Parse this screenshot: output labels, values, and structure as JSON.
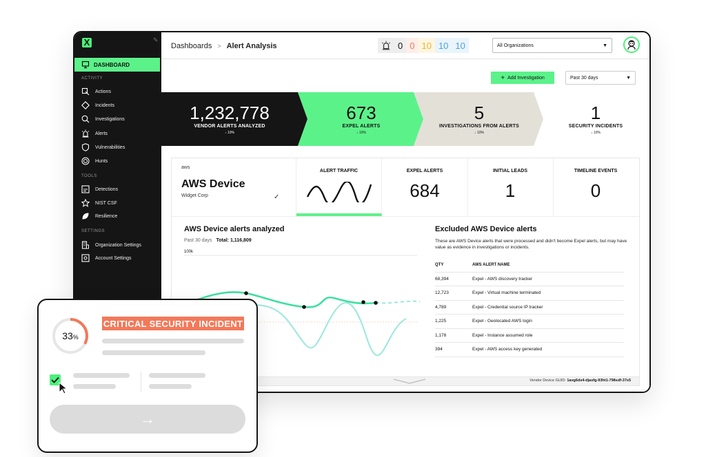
{
  "sidebar": {
    "logo": "X",
    "active_item": {
      "label": "DASHBOARD",
      "icon": "monitor-icon"
    },
    "sections": [
      {
        "label": "ACTIVITY",
        "items": [
          {
            "label": "Actions",
            "icon": "actions-icon"
          },
          {
            "label": "Incidents",
            "icon": "diamond-icon"
          },
          {
            "label": "Investigations",
            "icon": "magnifier-icon"
          },
          {
            "label": "Alerts",
            "icon": "siren-icon"
          },
          {
            "label": "Vulnerabilities",
            "icon": "shield-icon"
          },
          {
            "label": "Hunts",
            "icon": "target-icon"
          }
        ]
      },
      {
        "label": "TOOLS",
        "items": [
          {
            "label": "Detections",
            "icon": "detections-icon"
          },
          {
            "label": "NIST CSF",
            "icon": "star-icon"
          },
          {
            "label": "Resilience",
            "icon": "leaf-icon"
          }
        ]
      },
      {
        "label": "SETTINGS",
        "items": [
          {
            "label": "Organization Settings",
            "icon": "building-icon"
          },
          {
            "label": "Account Settings",
            "icon": "account-icon"
          }
        ]
      }
    ]
  },
  "header": {
    "breadcrumb": [
      "Dashboards",
      "Alert Analysis"
    ],
    "alert_counts": [
      {
        "value": "0",
        "color": "#111111"
      },
      {
        "value": "0",
        "color": "#f2795a"
      },
      {
        "value": "10",
        "color": "#f0b429"
      },
      {
        "value": "10",
        "color": "#4aa3df"
      },
      {
        "value": "10",
        "color": "#4aa3df"
      }
    ],
    "org_select": "All Organizations"
  },
  "toolbar": {
    "add_label": "Add Investigation",
    "range_label": "Past 30 days"
  },
  "kpis": [
    {
      "value": "1,232,778",
      "label": "VENDOR ALERTS ANALYZED",
      "delta": "10%"
    },
    {
      "value": "673",
      "label": "EXPEL ALERTS",
      "delta": "10%"
    },
    {
      "value": "5",
      "label": "INVESTIGATIONS FROM ALERTS",
      "delta": "10%"
    },
    {
      "value": "1",
      "label": "SECURITY INCIDENTS",
      "delta": "10%"
    }
  ],
  "device": {
    "vendor": "aws",
    "title": "AWS Device",
    "subtitle": "Widget Corp"
  },
  "tabs": [
    {
      "label": "ALERT TRAFFIC",
      "value": ""
    },
    {
      "label": "EXPEL ALERTS",
      "value": "684"
    },
    {
      "label": "INITIAL LEADS",
      "value": "1"
    },
    {
      "label": "TIMELINE EVENTS",
      "value": "0"
    }
  ],
  "analyzed": {
    "title": "AWS Device alerts analyzed",
    "period": "Past 30 days",
    "total": "Total: 1,116,809",
    "y_tick": "100k"
  },
  "excluded": {
    "title": "Excluded AWS Device alerts",
    "description": "These are AWS Device alerts that were processed and didn't become Expel alerts, but may have value as evidence in investigations or incidents.",
    "columns": [
      "QTY",
      "AWS ALERT NAME"
    ],
    "rows": [
      {
        "qty": "68,394",
        "name": "Expel - AWS discovery tracker"
      },
      {
        "qty": "12,723",
        "name": "Expel - Virtual machine terminated"
      },
      {
        "qty": "4,789",
        "name": "Expel - Credential source IP tracker"
      },
      {
        "qty": "1,225",
        "name": "Expel - Geolocated AWS login"
      },
      {
        "qty": "1,178",
        "name": "Expel - Instance assumed role"
      },
      {
        "qty": "394",
        "name": "Expel - AWS access key generated"
      }
    ]
  },
  "footer": {
    "guid_label": "Vendor Device GUID:",
    "guid_value": "1avg6ds4-djasfg-93ht1-798sdf-37s5"
  },
  "incident_card": {
    "progress_value": "33",
    "progress_unit": "%",
    "progress_fraction": 0.33,
    "title": "CRITICAL SECURITY INCIDENT"
  },
  "colors": {
    "accent": "#5cf28a",
    "dark": "#151515",
    "beige": "#e3e0d8",
    "alert": "#f2795a"
  }
}
